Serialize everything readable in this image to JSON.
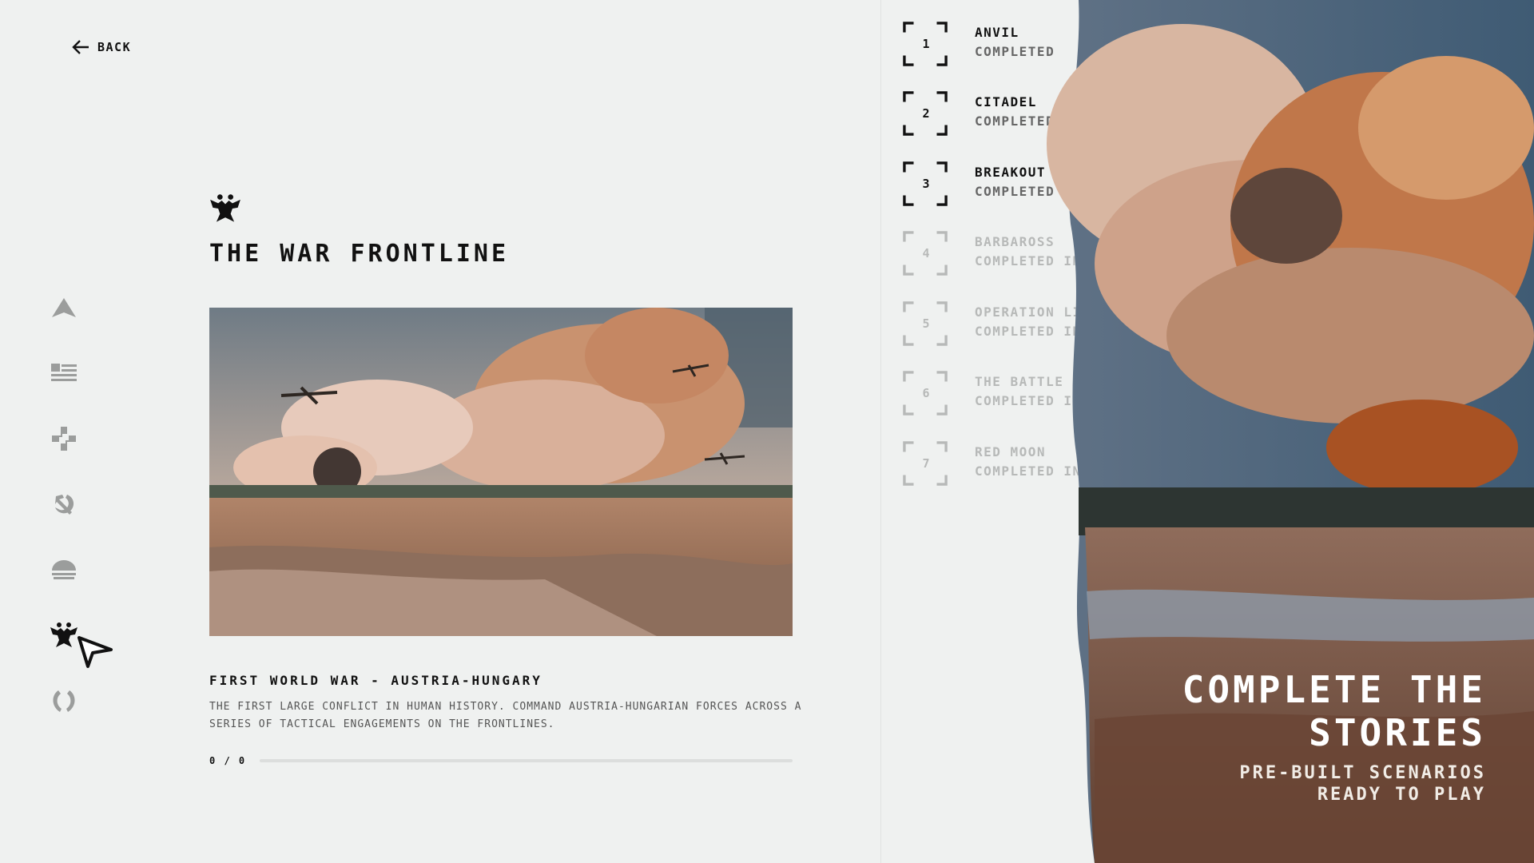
{
  "back": {
    "label": "BACK",
    "icon": "arrow-left-icon"
  },
  "nav": {
    "items": [
      {
        "id": "faction-1",
        "icon": "chevron-up-icon",
        "active": false
      },
      {
        "id": "faction-2",
        "icon": "flag-icon",
        "active": false
      },
      {
        "id": "faction-3",
        "icon": "cross-icon",
        "active": false
      },
      {
        "id": "faction-4",
        "icon": "hammer-sickle-icon",
        "active": false
      },
      {
        "id": "faction-5",
        "icon": "sun-icon",
        "active": false
      },
      {
        "id": "faction-6",
        "icon": "eagle-icon",
        "active": true
      },
      {
        "id": "faction-7",
        "icon": "wreath-icon",
        "active": false
      }
    ]
  },
  "main": {
    "title": "THE WAR FRONTLINE",
    "emblem_icon": "eagle-icon",
    "scenario_title": "FIRST WORLD WAR - AUSTRIA-HUNGARY",
    "scenario_description": "THE FIRST LARGE CONFLICT IN HUMAN HISTORY. COMMAND AUSTRIA-HUNGARIAN FORCES ACROSS A SERIES OF TACTICAL ENGAGEMENTS ON THE FRONTLINES.",
    "progress_label": "0 / 0",
    "progress_fraction": 0
  },
  "missions": [
    {
      "number": "1",
      "name": "ANVIL",
      "status": "COMPLETED",
      "locked": false
    },
    {
      "number": "2",
      "name": "CITADEL",
      "status": "COMPLETED",
      "locked": false
    },
    {
      "number": "3",
      "name": "BREAKOUT",
      "status": "COMPLETED",
      "locked": false
    },
    {
      "number": "4",
      "name": "BARBAROSS",
      "status": "COMPLETED IN",
      "locked": true
    },
    {
      "number": "5",
      "name": "OPERATION LI",
      "status": "COMPLETED IN",
      "locked": true
    },
    {
      "number": "6",
      "name": "THE BATTLE OF",
      "status": "COMPLETED IN",
      "locked": true
    },
    {
      "number": "7",
      "name": "RED MOON",
      "status": "COMPLETED IN",
      "locked": true
    }
  ],
  "promo": {
    "title": "COMPLETE THE STORIES",
    "subtitle": "PRE-BUILT SCENARIOS READY TO PLAY"
  },
  "colors": {
    "background": "#eff1f0",
    "text": "#111111",
    "muted": "#b7b9b8",
    "accent_smoke": "#c98a60"
  }
}
